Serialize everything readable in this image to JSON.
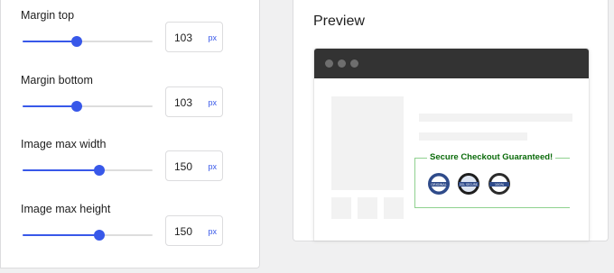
{
  "colors": {
    "accent": "#3858e9",
    "heading_green": "#0a6b0a",
    "browser_bar": "#333333"
  },
  "settings": {
    "fields": [
      {
        "label": "Margin top",
        "value": "103",
        "unit": "px",
        "slider_fraction": 0.42
      },
      {
        "label": "Margin bottom",
        "value": "103",
        "unit": "px",
        "slider_fraction": 0.42
      },
      {
        "label": "Image max width",
        "value": "150",
        "unit": "px",
        "slider_fraction": 0.59
      },
      {
        "label": "Image max height",
        "value": "150",
        "unit": "px",
        "slider_fraction": 0.59
      }
    ]
  },
  "preview": {
    "title": "Preview",
    "badge_heading": "Secure Checkout Guaranteed!",
    "seals": [
      {
        "icon": "original-seal-icon",
        "text": "ORIGINAL",
        "style": "light"
      },
      {
        "icon": "ssl-secure-seal-icon",
        "text": "SSL SECURE",
        "style": "dark"
      },
      {
        "icon": "guarantee-seal-icon",
        "text": "100%",
        "style": "light"
      }
    ]
  }
}
